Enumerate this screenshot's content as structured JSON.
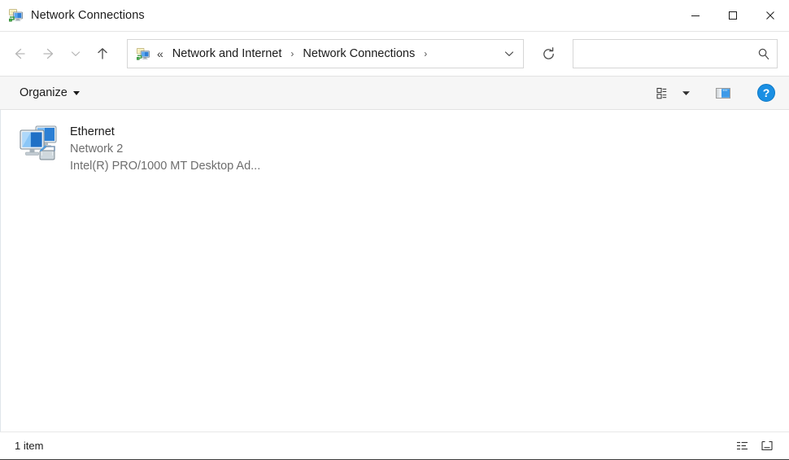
{
  "window": {
    "title": "Network Connections",
    "icon": "network-connections-icon",
    "controls": {
      "minimize": "minimize-icon",
      "maximize": "maximize-icon",
      "close": "close-icon"
    }
  },
  "navbar": {
    "back": "back-arrow-icon",
    "forward": "forward-arrow-icon",
    "recent": "chevron-down-icon",
    "up": "up-arrow-icon",
    "refresh": "refresh-icon"
  },
  "address": {
    "icon": "network-connections-icon",
    "overflow": "«",
    "crumbs": [
      {
        "label": "Network and Internet"
      },
      {
        "label": "Network Connections"
      }
    ],
    "separator": "›",
    "dropdown": "chevron-down-icon"
  },
  "search": {
    "value": "",
    "placeholder": "",
    "icon": "search-icon"
  },
  "toolbar": {
    "organize_label": "Organize",
    "organize_caret": "chevron-down-icon",
    "view_options_icon": "list-view-icon",
    "view_options_caret": "chevron-down-icon",
    "preview_pane_icon": "preview-pane-icon",
    "help_icon": "help-icon"
  },
  "content": {
    "items": [
      {
        "icon": "network-adapter-icon",
        "name": "Ethernet",
        "network": "Network 2",
        "adapter": "Intel(R) PRO/1000 MT Desktop Ad..."
      }
    ]
  },
  "statusbar": {
    "count_text": "1 item",
    "details_view_icon": "details-view-icon",
    "large_icons_view_icon": "large-icons-view-icon"
  },
  "colors": {
    "accent_blue": "#0f8ce0",
    "title_text": "#1b1b1b",
    "secondary_text": "#6e6e6e",
    "command_bar_bg": "#f6f6f6",
    "border": "#d6d6d6"
  }
}
